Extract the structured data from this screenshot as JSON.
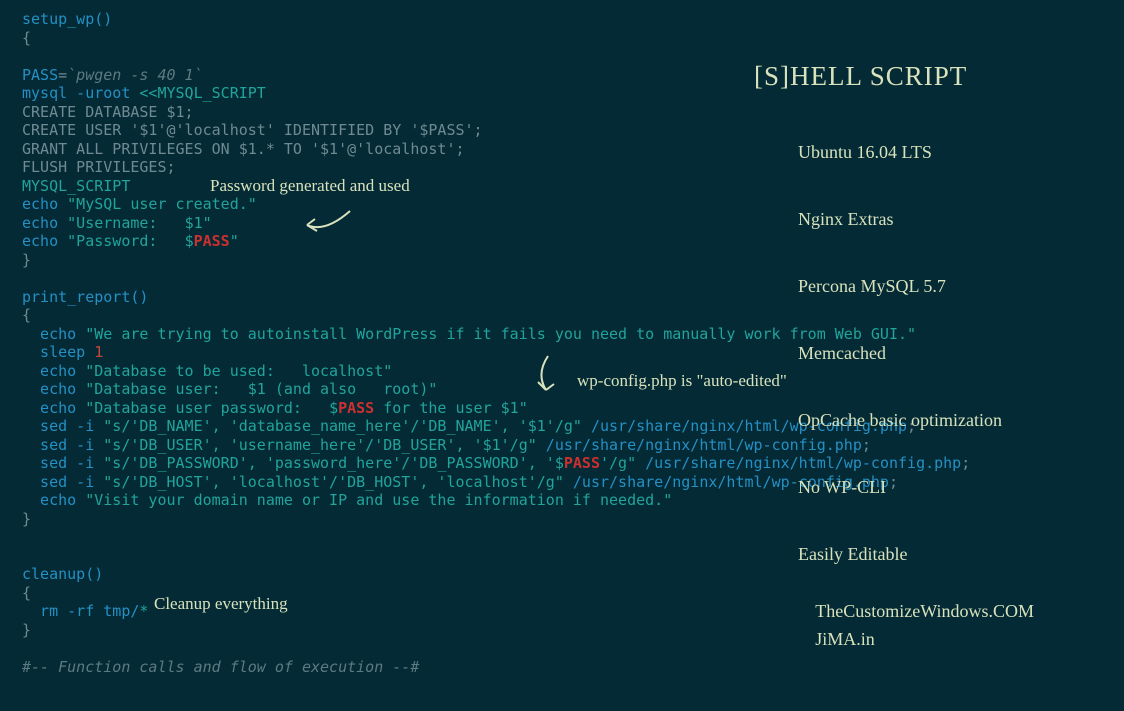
{
  "panel": {
    "title": "[S]HELL SCRIPT",
    "items": [
      "Ubuntu 16.04 LTS",
      "Nginx Extras",
      "Percona MySQL 5.7",
      "Memcached",
      "OpCache basic optimization",
      "No WP-CLI",
      "Easily Editable"
    ]
  },
  "annotations": {
    "pass_generated": "Password generated and used",
    "cleanup": "Cleanup everything",
    "wpconfig": "wp-config.php is \"auto-edited\""
  },
  "footer": {
    "line1": "TheCustomizeWindows.COM",
    "line2": "JiMA.in"
  },
  "code": {
    "l01_fn": "setup_wp()",
    "l02_br": "{",
    "l04_pass": "PASS",
    "l04_eq": "=",
    "l04_bt": "`pwgen -s 40 1`",
    "l05_mysql": "mysql -uroot ",
    "l05_here": "<<MYSQL_SCRIPT",
    "l06": "CREATE DATABASE $1;",
    "l07": "CREATE USER '$1'@'localhost' IDENTIFIED BY '$PASS';",
    "l08": "GRANT ALL PRIVILEGES ON $1.* TO '$1'@'localhost';",
    "l09": "FLUSH PRIVILEGES;",
    "l10": "MYSQL_SCRIPT",
    "l11_echo": "echo ",
    "l11_str": "\"MySQL user created.\"",
    "l12_echo": "echo ",
    "l12_str1": "\"Username:   ",
    "l12_arg": "$1",
    "l12_str2": "\"",
    "l13_echo": "echo ",
    "l13_str1": "\"Password:   ",
    "l13_dol": "$",
    "l13_var": "PASS",
    "l13_str2": "\"",
    "l14_br": "}",
    "l16_fn": "print_report()",
    "l17_br": "{",
    "l18_echo": "  echo ",
    "l18_str": "\"We are trying to autoinstall WordPress if it fails you need to manually work from Web GUI.\"",
    "l19_sleep": "  sleep ",
    "l19_num": "1",
    "l20_echo": "  echo ",
    "l20_str": "\"Database to be used:   localhost\"",
    "l21_echo": "  echo ",
    "l21_str1": "\"Database user:   ",
    "l21_arg": "$1",
    "l21_str2": " (and also   root)\"",
    "l22_echo": "  echo ",
    "l22_str1": "\"Database user password:   ",
    "l22_dol": "$",
    "l22_var": "PASS",
    "l22_str2": " for the user ",
    "l22_arg": "$1",
    "l22_str3": "\"",
    "l23_sed": "  sed -i ",
    "l23_str1": "\"s/'DB_NAME', 'database_name_here'/'DB_NAME', '",
    "l23_arg": "$1",
    "l23_str2": "'/g\"",
    "l23_sp": " ",
    "l23_path": "/usr/share/nginx/html/wp-config.php",
    "l23_end": ";",
    "l24_sed": "  sed -i ",
    "l24_str1": "\"s/'DB_USER', 'username_here'/'DB_USER', '",
    "l24_arg": "$1",
    "l24_str2": "'/g\"",
    "l24_sp": " ",
    "l24_path": "/usr/share/nginx/html/wp-config.php",
    "l24_end": ";",
    "l25_sed": "  sed -i ",
    "l25_str1": "\"s/'DB_PASSWORD', 'password_here'/'DB_PASSWORD', '",
    "l25_dol": "$",
    "l25_var": "PASS",
    "l25_str2": "'/g\"",
    "l25_sp": " ",
    "l25_path": "/usr/share/nginx/html/wp-config.php",
    "l25_end": ";",
    "l26_sed": "  sed -i ",
    "l26_str1": "\"s/'DB_HOST', 'localhost'/'DB_HOST', 'localhost'/g\"",
    "l26_sp": " ",
    "l26_path": "/usr/share/nginx/html/wp-config.php",
    "l26_end": ";",
    "l27_echo": "  echo ",
    "l27_str": "\"Visit your domain name or IP and use the information if needed.\"",
    "l28_br": "}",
    "l31_fn": "cleanup()",
    "l32_br": "{",
    "l33_rm": "  rm -rf tmp/",
    "l33_star": "*",
    "l34_br": "}",
    "l36_cmt": "#-- Function calls and flow of execution --#"
  }
}
